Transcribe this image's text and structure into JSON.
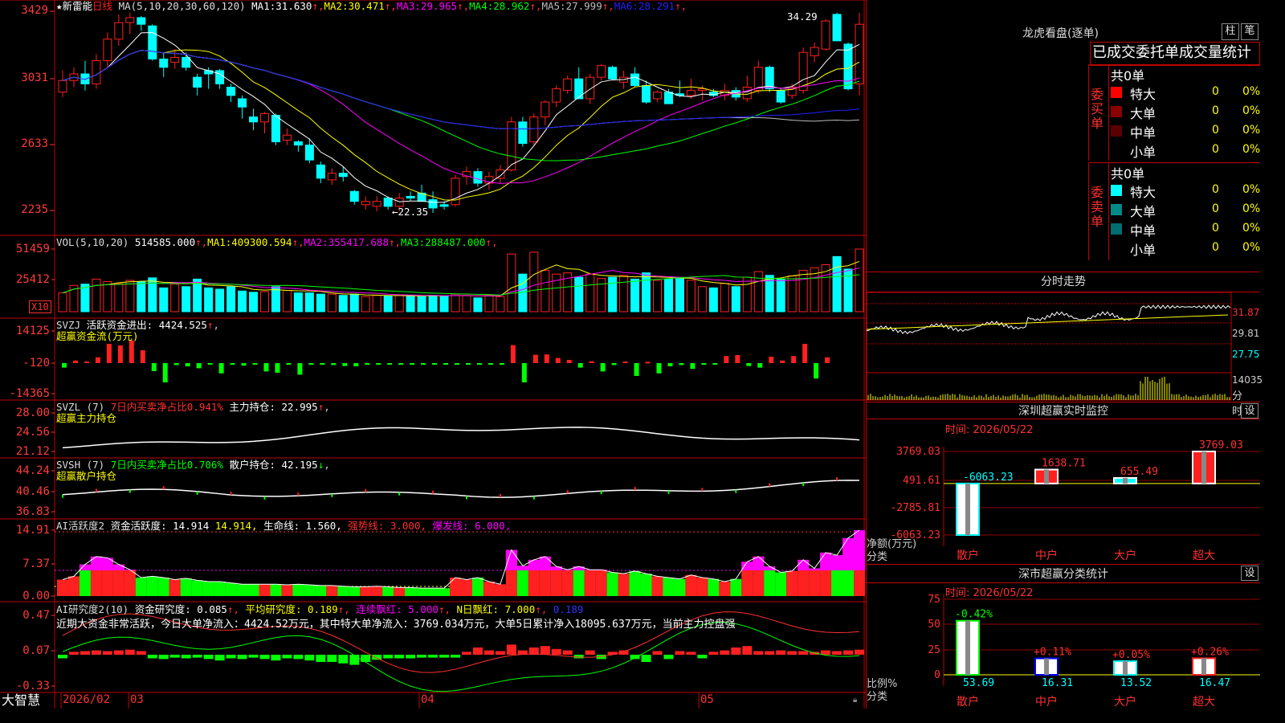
{
  "stock": {
    "name": "★新雷能",
    "period": "日线"
  },
  "colors": {
    "up": "#ff2020",
    "down": "#00ffff",
    "grid": "#c00000",
    "ma1": "#ffffff",
    "ma2": "#ffff00",
    "ma3": "#ff00ff",
    "ma4": "#00ff00",
    "ma5": "#bbbbbb",
    "ma6": "#2020ff"
  },
  "price_panel": {
    "ma_label": "MA(5,10,20,30,60,120)",
    "ma": [
      {
        "name": "MA1:",
        "value": "31.630"
      },
      {
        "name": "MA2:",
        "value": "30.471"
      },
      {
        "name": "MA3:",
        "value": "29.965"
      },
      {
        "name": "MA4:",
        "value": "28.962"
      },
      {
        "name": "MA5:",
        "value": "27.999"
      },
      {
        "name": "MA6:",
        "value": "28.291"
      }
    ],
    "ticks": [
      "3429",
      "3031",
      "2633",
      "2235"
    ],
    "high_label": "34.29",
    "low_label": "22.35",
    "ohlc": [
      [
        29.5,
        30.8,
        29.2,
        30.2
      ],
      [
        30.2,
        31.0,
        29.8,
        30.6
      ],
      [
        30.6,
        31.4,
        29.6,
        30.0
      ],
      [
        30.0,
        31.8,
        29.7,
        31.4
      ],
      [
        31.4,
        33.1,
        31.0,
        32.7
      ],
      [
        32.7,
        34.2,
        32.3,
        33.7
      ],
      [
        33.7,
        34.3,
        33.0,
        34.0
      ],
      [
        34.0,
        34.1,
        33.2,
        33.6
      ],
      [
        33.5,
        33.6,
        31.4,
        31.5
      ],
      [
        31.5,
        31.9,
        30.4,
        31.0
      ],
      [
        31.3,
        32.1,
        30.9,
        31.6
      ],
      [
        31.6,
        31.9,
        30.8,
        31.0
      ],
      [
        30.4,
        30.6,
        29.3,
        29.8
      ],
      [
        30.8,
        31.0,
        29.7,
        30.6
      ],
      [
        30.8,
        30.9,
        29.7,
        30.0
      ],
      [
        29.8,
        30.0,
        28.9,
        29.3
      ],
      [
        29.1,
        29.3,
        27.9,
        28.6
      ],
      [
        28.0,
        28.5,
        27.2,
        27.7
      ],
      [
        27.7,
        28.3,
        27.0,
        28.2
      ],
      [
        28.1,
        28.2,
        26.3,
        26.5
      ],
      [
        26.6,
        27.3,
        26.3,
        26.9
      ],
      [
        26.5,
        26.6,
        25.9,
        26.3
      ],
      [
        26.3,
        26.7,
        25.2,
        25.4
      ],
      [
        25.1,
        25.3,
        24.0,
        24.3
      ],
      [
        24.2,
        24.9,
        23.9,
        24.6
      ],
      [
        24.6,
        25.0,
        24.1,
        24.4
      ],
      [
        23.5,
        23.6,
        22.7,
        22.9
      ],
      [
        22.7,
        23.2,
        22.4,
        22.9
      ],
      [
        22.6,
        23.2,
        22.3,
        22.9
      ],
      [
        23.1,
        23.2,
        22.4,
        22.6
      ],
      [
        22.6,
        23.4,
        22.3,
        23.1
      ],
      [
        23.2,
        23.5,
        22.9,
        23.1
      ],
      [
        23.4,
        23.9,
        23.0,
        22.9
      ],
      [
        23.0,
        23.5,
        22.2,
        22.5
      ],
      [
        22.7,
        22.9,
        22.4,
        22.6
      ],
      [
        22.7,
        24.5,
        22.6,
        24.3
      ],
      [
        24.4,
        25.0,
        23.9,
        24.7
      ],
      [
        24.7,
        24.9,
        23.8,
        24.0
      ],
      [
        24.0,
        24.7,
        23.6,
        24.4
      ],
      [
        24.3,
        25.1,
        24.0,
        24.8
      ],
      [
        24.8,
        28.0,
        24.7,
        27.7
      ],
      [
        27.7,
        28.0,
        26.2,
        26.4
      ],
      [
        26.5,
        28.2,
        26.3,
        28.0
      ],
      [
        28.0,
        29.0,
        27.5,
        28.9
      ],
      [
        28.9,
        29.9,
        28.6,
        29.7
      ],
      [
        29.6,
        30.5,
        29.4,
        30.3
      ],
      [
        30.3,
        31.0,
        29.1,
        29.1
      ],
      [
        29.1,
        30.6,
        28.8,
        30.4
      ],
      [
        30.4,
        31.2,
        30.2,
        31.1
      ],
      [
        31.0,
        31.1,
        30.2,
        30.3
      ],
      [
        30.1,
        30.8,
        29.7,
        30.4
      ],
      [
        30.6,
        31.0,
        29.8,
        29.9
      ],
      [
        29.9,
        30.2,
        28.8,
        28.9
      ],
      [
        29.1,
        29.6,
        28.9,
        29.5
      ],
      [
        29.5,
        29.7,
        28.8,
        28.8
      ],
      [
        29.4,
        30.2,
        29.2,
        29.3
      ],
      [
        29.3,
        30.3,
        29.1,
        29.6
      ],
      [
        29.6,
        29.9,
        29.0,
        29.7
      ],
      [
        29.5,
        29.7,
        29.2,
        29.3
      ],
      [
        29.3,
        30.0,
        29.0,
        29.6
      ],
      [
        29.6,
        29.8,
        29.0,
        29.2
      ],
      [
        29.1,
        30.5,
        28.9,
        29.8
      ],
      [
        29.6,
        31.4,
        29.4,
        31.0
      ],
      [
        31.0,
        31.1,
        29.5,
        29.7
      ],
      [
        29.6,
        29.7,
        28.8,
        28.9
      ],
      [
        29.3,
        30.0,
        29.1,
        29.8
      ],
      [
        29.6,
        32.2,
        29.4,
        31.9
      ],
      [
        31.7,
        32.5,
        31.3,
        32.2
      ],
      [
        32.1,
        33.9,
        32.0,
        33.8
      ],
      [
        34.2,
        34.3,
        32.6,
        32.6
      ],
      [
        32.4,
        32.5,
        29.6,
        29.7
      ],
      [
        30.0,
        34.29,
        29.3,
        33.6
      ]
    ]
  },
  "vol_panel": {
    "label": "VOL(5,10,20)",
    "values": [
      {
        "name": "",
        "value": "514585.000"
      },
      {
        "name": "MA1:",
        "value": "409300.594"
      },
      {
        "name": "MA2:",
        "value": "355417.688"
      },
      {
        "name": "MA3:",
        "value": "288487.000"
      }
    ],
    "ticks": [
      "51459",
      "25412"
    ],
    "unit": "X10",
    "bars": [
      0.3,
      0.42,
      0.44,
      0.52,
      0.48,
      0.45,
      0.5,
      0.48,
      0.54,
      0.38,
      0.44,
      0.4,
      0.52,
      0.38,
      0.36,
      0.4,
      0.33,
      0.31,
      0.32,
      0.4,
      0.34,
      0.3,
      0.3,
      0.28,
      0.28,
      0.26,
      0.28,
      0.24,
      0.26,
      0.25,
      0.26,
      0.26,
      0.24,
      0.26,
      0.25,
      0.28,
      0.26,
      0.22,
      0.26,
      0.24,
      0.92,
      0.6,
      0.95,
      0.66,
      0.6,
      0.62,
      0.55,
      0.6,
      0.53,
      0.55,
      0.58,
      0.52,
      0.62,
      0.5,
      0.52,
      0.53,
      0.5,
      0.4,
      0.38,
      0.45,
      0.4,
      0.55,
      0.64,
      0.58,
      0.52,
      0.57,
      0.66,
      0.7,
      0.75,
      0.88,
      0.68,
      1.0
    ]
  },
  "svzj_panel": {
    "label": "SVZJ",
    "title": "活跃资金进出:",
    "value": "4424.525",
    "subtitle": "超赢资金流(万元)",
    "ticks": [
      "14125",
      "-120",
      "-14365"
    ],
    "bars": [
      -0.14,
      0.08,
      0.05,
      0.18,
      0.6,
      0.55,
      0.7,
      0.4,
      -0.25,
      -0.6,
      -0.06,
      -0.1,
      -0.16,
      -0.04,
      -0.32,
      -0.03,
      -0.08,
      -0.03,
      -0.26,
      -0.3,
      -0.04,
      -0.36,
      -0.04,
      -0.04,
      -0.06,
      -0.09,
      -0.1,
      -0.04,
      -0.04,
      -0.04,
      -0.04,
      -0.05,
      -0.04,
      -0.03,
      -0.03,
      -0.03,
      -0.03,
      -0.03,
      -0.03,
      -0.03,
      0.56,
      -0.6,
      0.26,
      0.27,
      0.16,
      0.1,
      -0.14,
      0.06,
      -0.26,
      -0.06,
      0.05,
      -0.4,
      0.04,
      -0.32,
      -0.1,
      -0.06,
      -0.18,
      -0.04,
      -0.05,
      0.22,
      0.25,
      -0.09,
      -0.14,
      0.2,
      0.08,
      0.22,
      0.6,
      -0.48,
      0.18
    ]
  },
  "svzl_panel": {
    "label": "SVZL (7)",
    "desc": "7日内买卖净占比0.941%",
    "hold_label": "主力持仓:",
    "value": "22.995",
    "subtitle": "超赢主力持仓",
    "ticks": [
      "28.00",
      "24.56",
      "21.12"
    ]
  },
  "svsh_panel": {
    "label": "SVSH (7)",
    "desc": "7日内买卖净占比0.706%",
    "hold_label": "散户持仓:",
    "value": "42.195",
    "subtitle": "超赢散户持仓",
    "ticks": [
      "44.24",
      "40.46",
      "36.83"
    ]
  },
  "ai_panel": {
    "label": "AI活跃度2",
    "items": [
      {
        "text": "资金活跃度: 14.914",
        "color": "#ffffff"
      },
      {
        "text": "14.914,",
        "color": "#ffff00"
      },
      {
        "text": "生命线: 1.560,",
        "color": "#ffffff"
      },
      {
        "text": "强势线: 3.000,",
        "color": "#ff3030"
      },
      {
        "text": "爆发线: 6.000,",
        "color": "#ff00ff"
      }
    ],
    "ticks": [
      "14.91",
      "7.37",
      "0.00"
    ],
    "bars": [
      0.25,
      0.3,
      0.48,
      0.6,
      0.58,
      0.48,
      0.4,
      0.28,
      0.3,
      0.28,
      0.25,
      0.27,
      0.24,
      0.22,
      0.22,
      0.2,
      0.18,
      0.18,
      0.18,
      0.18,
      0.17,
      0.18,
      0.17,
      0.16,
      0.16,
      0.15,
      0.14,
      0.14,
      0.15,
      0.14,
      0.13,
      0.13,
      0.12,
      0.12,
      0.12,
      0.28,
      0.25,
      0.28,
      0.22,
      0.18,
      0.7,
      0.46,
      0.55,
      0.6,
      0.45,
      0.4,
      0.45,
      0.4,
      0.4,
      0.36,
      0.34,
      0.38,
      0.34,
      0.3,
      0.28,
      0.26,
      0.32,
      0.28,
      0.26,
      0.22,
      0.26,
      0.52,
      0.6,
      0.45,
      0.36,
      0.38,
      0.55,
      0.42,
      0.66,
      0.62,
      0.88,
      1.0
    ]
  },
  "ai2_panel": {
    "label": "AI研究度2(10)",
    "items": [
      {
        "text": "资金研究度: 0.085",
        "color": "#ffffff"
      },
      {
        "text": "平均研究度: 0.189",
        "color": "#ffff00"
      },
      {
        "text": "连续飘红: 5.000",
        "color": "#ff00ff"
      },
      {
        "text": "N日飘红: 7.000",
        "color": "#ffff00"
      },
      {
        "text": "0.189",
        "color": "#3030ff"
      }
    ],
    "summary": "近期大资金非常活跃，今日大单净流入：4424.52万元，其中特大单净流入：3769.034万元，大单5日累计净入18095.637万元，当前主力控盘强",
    "ticks": [
      "0.47",
      "0.07",
      "-0.33"
    ],
    "bars": [
      -0.05,
      0.04,
      0.05,
      0.06,
      0.05,
      0.06,
      0.07,
      0.05,
      -0.05,
      -0.06,
      -0.04,
      -0.05,
      -0.04,
      -0.06,
      -0.08,
      -0.05,
      -0.06,
      -0.04,
      -0.06,
      -0.08,
      -0.05,
      -0.06,
      -0.08,
      -0.1,
      -0.1,
      -0.12,
      -0.14,
      -0.1,
      -0.07,
      -0.05,
      -0.05,
      -0.05,
      -0.04,
      -0.04,
      -0.04,
      -0.04,
      0.04,
      0.1,
      0.06,
      0.05,
      0.14,
      0.06,
      0.1,
      0.12,
      0.08,
      0.06,
      -0.05,
      0.06,
      -0.06,
      0.04,
      0.06,
      -0.06,
      -0.1,
      0.05,
      -0.06,
      0.05,
      0.04,
      -0.05,
      0.04,
      0.06,
      0.1,
      0.12,
      0.05,
      0.05,
      0.06,
      0.05,
      0.05,
      0.04,
      0.06,
      0.05,
      0.06,
      0.07
    ]
  },
  "bottom_axis": {
    "brand": "大智慧",
    "labels": [
      "2026/02",
      "03",
      "04",
      "05"
    ]
  },
  "dragon_tiger": {
    "title": "龙虎看盘(逐单)",
    "btn_col": "柱",
    "btn_grid": "笔",
    "header": "已成交委托单成交量统计",
    "buy": {
      "side": "委买单",
      "total": "共0单",
      "rows": [
        {
          "label": "特大",
          "val": "0",
          "pct": "0%",
          "color": "#ff0000"
        },
        {
          "label": "大单",
          "val": "0",
          "pct": "0%",
          "color": "#8b0000"
        },
        {
          "label": "中单",
          "val": "0",
          "pct": "0%",
          "color": "#5a0000"
        },
        {
          "label": "小单",
          "val": "0",
          "pct": "0%",
          "color": ""
        }
      ]
    },
    "sell": {
      "side": "委卖单",
      "total": "共0单",
      "rows": [
        {
          "label": "特大",
          "val": "0",
          "pct": "0%",
          "color": "#00ffff"
        },
        {
          "label": "大单",
          "val": "0",
          "pct": "0%",
          "color": "#008b8b"
        },
        {
          "label": "中单",
          "val": "0",
          "pct": "0%",
          "color": "#006e6e"
        },
        {
          "label": "小单",
          "val": "0",
          "pct": "0%",
          "color": ""
        }
      ]
    }
  },
  "intraday": {
    "title": "分时走势",
    "ticks": [
      "31.87",
      "29.81",
      "27.75"
    ],
    "vol_tick": "14035",
    "vol_label": "分时"
  },
  "realtime": {
    "title": "深圳超赢实时监控",
    "btn": "设",
    "time": "时间: 2026/05/22",
    "ylabel": "净额(万元)",
    "xlabel": "分类",
    "ticks": [
      "3769.03",
      "491.61",
      "-2785.81",
      "-6063.23"
    ],
    "cats": [
      {
        "name": "散户",
        "value": -6063.23,
        "label": "-6063.23"
      },
      {
        "name": "中户",
        "value": 1638.71,
        "label": "1638.71"
      },
      {
        "name": "大户",
        "value": 655.49,
        "label": "655.49"
      },
      {
        "name": "超大",
        "value": 3769.03,
        "label": "3769.03"
      }
    ]
  },
  "classify": {
    "title": "深市超赢分类统计",
    "btn": "设",
    "time": "时间: 2026/05/22",
    "ylabel": "比例%",
    "xlabel": "分类",
    "ticks": [
      "75",
      "50",
      "25",
      "0"
    ],
    "cats": [
      {
        "name": "散户",
        "value": 53.69,
        "label": "53.69",
        "change": "-0.42%"
      },
      {
        "name": "中户",
        "value": 16.31,
        "label": "16.31",
        "change": "+0.11%"
      },
      {
        "name": "大户",
        "value": 13.52,
        "label": "13.52",
        "change": "+0.05%"
      },
      {
        "name": "超大",
        "value": 16.47,
        "label": "16.47",
        "change": "+0.26%"
      }
    ]
  }
}
